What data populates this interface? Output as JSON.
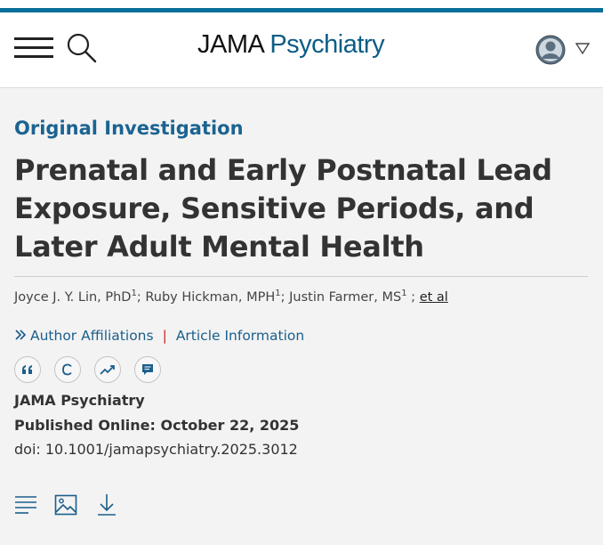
{
  "header": {
    "brand_primary": "JAMA",
    "brand_secondary": "Psychiatry",
    "accent_color": "#0b6f9c",
    "icons": [
      "menu-icon",
      "search-icon",
      "user-avatar-icon",
      "caret-down-icon"
    ]
  },
  "article": {
    "category": "Original Investigation",
    "title": "Prenatal and Early Postnatal Lead Exposure, Sensitive Periods, and Later Adult Mental Health",
    "authors": [
      {
        "name": "Joyce J. Y. Lin, PhD",
        "sup": "1"
      },
      {
        "name": "Ruby Hickman, MPH",
        "sup": "1"
      },
      {
        "name": "Justin Farmer, MS",
        "sup": "1"
      }
    ],
    "et_al": "et al",
    "author_affiliations": "Author Affiliations",
    "article_information": "Article Information",
    "journal": "JAMA Psychiatry",
    "published": "Published Online: October 22, 2025",
    "doi": "doi: 10.1001/jamapsychiatry.2025.3012"
  },
  "action_icons": [
    "quote-icon",
    "copyright-icon",
    "trend-icon",
    "comment-icon"
  ],
  "tool_icons": [
    "full-text-icon",
    "figures-icon",
    "download-icon"
  ]
}
